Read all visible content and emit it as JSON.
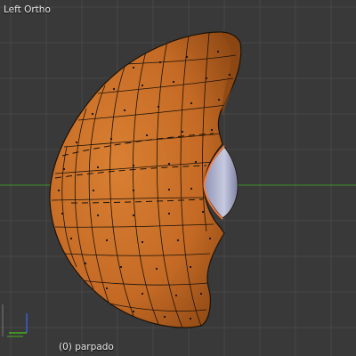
{
  "viewport": {
    "view_name": "Left Ortho",
    "object_info": "(0) parpado",
    "background_color": "#393939",
    "grid_color": "#474747",
    "horizontal_axis_color": "#3f8f2b",
    "mesh_color": "#c9702a",
    "mesh_shadow_color": "#8a4613",
    "wire_color": "#1c1208",
    "inner_surface_color": "#b8bcd6",
    "selected_edge_color": "#ff7a38"
  },
  "axis_gizmo": {
    "vertical_axis_color": "#3a5fd0",
    "horizontal_axis_color": "#48b020",
    "vertical_axis_name": "z-axis-icon",
    "horizontal_axis_name": "y-axis-icon"
  }
}
